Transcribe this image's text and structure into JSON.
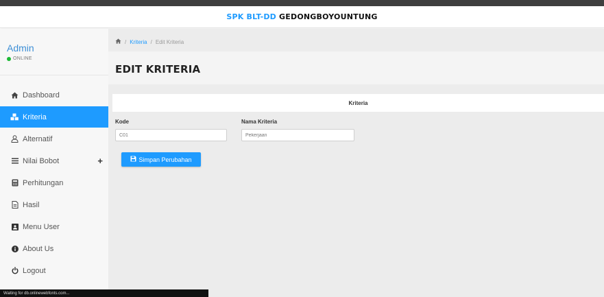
{
  "topbar": {
    "brand_accent": "SPK BLT-DD",
    "brand_rest": " GEDONGBOYOUNTUNG"
  },
  "user": {
    "name": "Admin",
    "status": "ONLINE"
  },
  "sidebar": {
    "items": [
      {
        "label": "Dashboard",
        "icon": "home-icon"
      },
      {
        "label": "Kriteria",
        "icon": "cubes-icon",
        "active": true
      },
      {
        "label": "Alternatif",
        "icon": "user-icon"
      },
      {
        "label": "Nilai Bobot",
        "icon": "bars-icon",
        "has_plus": true
      },
      {
        "label": "Perhitungan",
        "icon": "calculator-icon"
      },
      {
        "label": "Hasil",
        "icon": "file-icon"
      },
      {
        "label": "Menu User",
        "icon": "user-square-icon"
      },
      {
        "label": "About Us",
        "icon": "info-icon"
      },
      {
        "label": "Logout",
        "icon": "power-icon"
      }
    ],
    "plus": "+"
  },
  "breadcrumb": {
    "sep": "/",
    "link": "Kriteria",
    "current": "Edit Kriteria"
  },
  "page": {
    "title": "EDIT KRITERIA"
  },
  "panel": {
    "header": "Kriteria"
  },
  "form": {
    "kode_label": "Kode",
    "kode_value": "C01",
    "nama_label": "Nama Kriteria",
    "nama_value": "Pekerjaan",
    "save_label": "Simpan Perubahan"
  },
  "statusbar": {
    "text": "Waiting for db.onlinewebfonts.com..."
  },
  "colors": {
    "accent": "#1e9bff",
    "online": "#1bb934"
  }
}
